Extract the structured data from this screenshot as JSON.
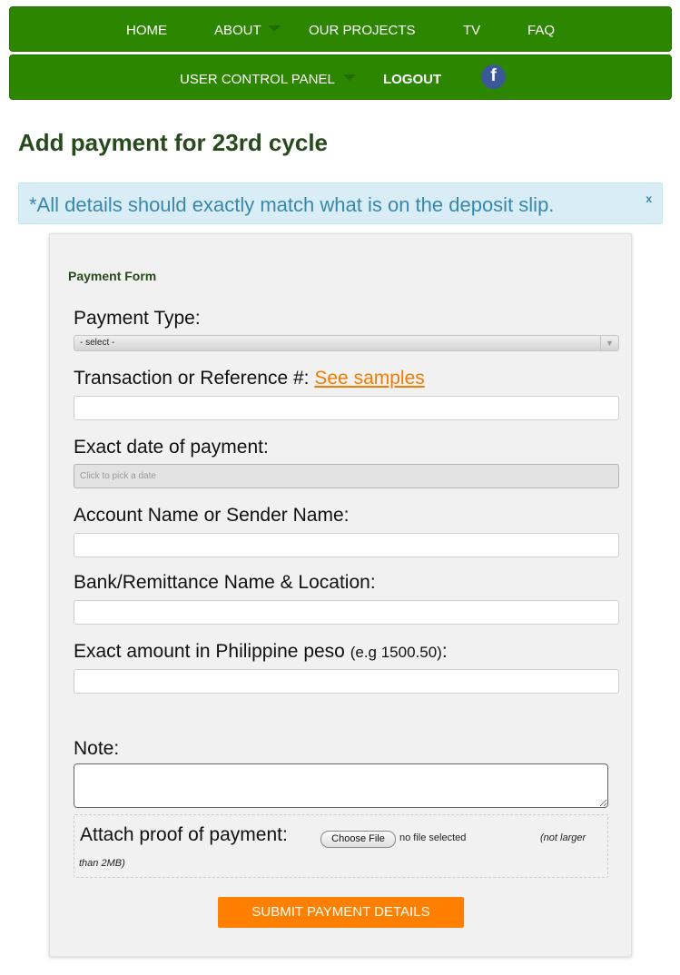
{
  "nav": {
    "home": "HOME",
    "about": "ABOUT",
    "projects": "OUR PROJECTS",
    "tv": "TV",
    "faq": "FAQ",
    "user_panel": "USER CONTROL PANEL",
    "logout": "LOGOUT",
    "facebook_glyph": "f"
  },
  "page": {
    "title": "Add payment for 23rd cycle"
  },
  "alert": {
    "text": "*All details should exactly match what is on the deposit slip.",
    "close": "x"
  },
  "form": {
    "heading": "Payment Form",
    "payment_type_label": "Payment Type:",
    "payment_type_value": "- select -",
    "reference_label": "Transaction or Reference #:",
    "see_samples": "See samples",
    "date_label": "Exact date of payment:",
    "date_placeholder": "Click to pick a date",
    "account_label": "Account Name or Sender Name:",
    "bank_label": "Bank/Remittance Name & Location:",
    "amount_label": "Exact amount in Philippine peso",
    "amount_example": "(e.g 1500.50)",
    "amount_colon": ":",
    "note_label": "Note:",
    "attach_label": "Attach proof of payment:",
    "choose_file": "Choose File",
    "file_status": "no file selected",
    "size_note_1": "(not larger",
    "size_note_2": "than 2MB)",
    "submit": "SUBMIT PAYMENT DETAILS"
  },
  "colors": {
    "nav_green": "#2c8600",
    "title_green": "#264a1c",
    "alert_blue": "#3a87ad",
    "accent_orange": "#ff7f00",
    "facebook_blue": "#3b5998"
  }
}
